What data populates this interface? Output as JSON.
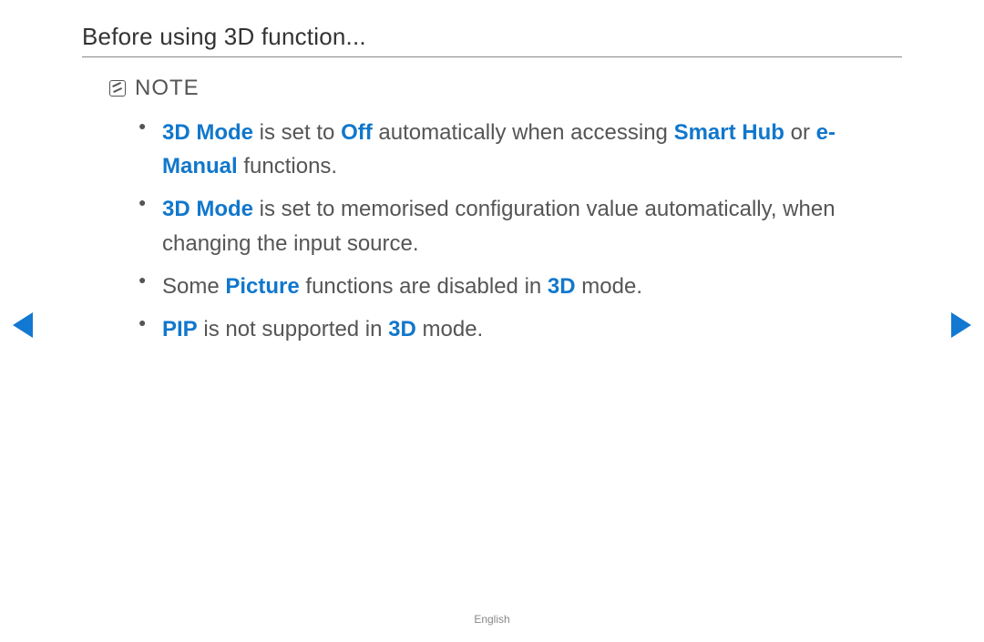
{
  "heading": "Before using 3D function...",
  "note": {
    "label": "NOTE"
  },
  "bullets": {
    "b1": {
      "t1": "3D Mode",
      "t2": " is set to ",
      "t3": "Off",
      "t4": " automatically when accessing ",
      "t5": "Smart Hub",
      "t6": " or ",
      "t7": "e-Manual",
      "t8": " functions."
    },
    "b2": {
      "t1": "3D Mode",
      "t2": " is set to memorised configuration value automatically, when changing the input source."
    },
    "b3": {
      "t1": "Some ",
      "t2": "Picture",
      "t3": " functions are disabled in ",
      "t4": "3D",
      "t5": " mode."
    },
    "b4": {
      "t1": "PIP",
      "t2": " is not supported in ",
      "t3": "3D",
      "t4": " mode."
    }
  },
  "footer": {
    "language": "English"
  }
}
